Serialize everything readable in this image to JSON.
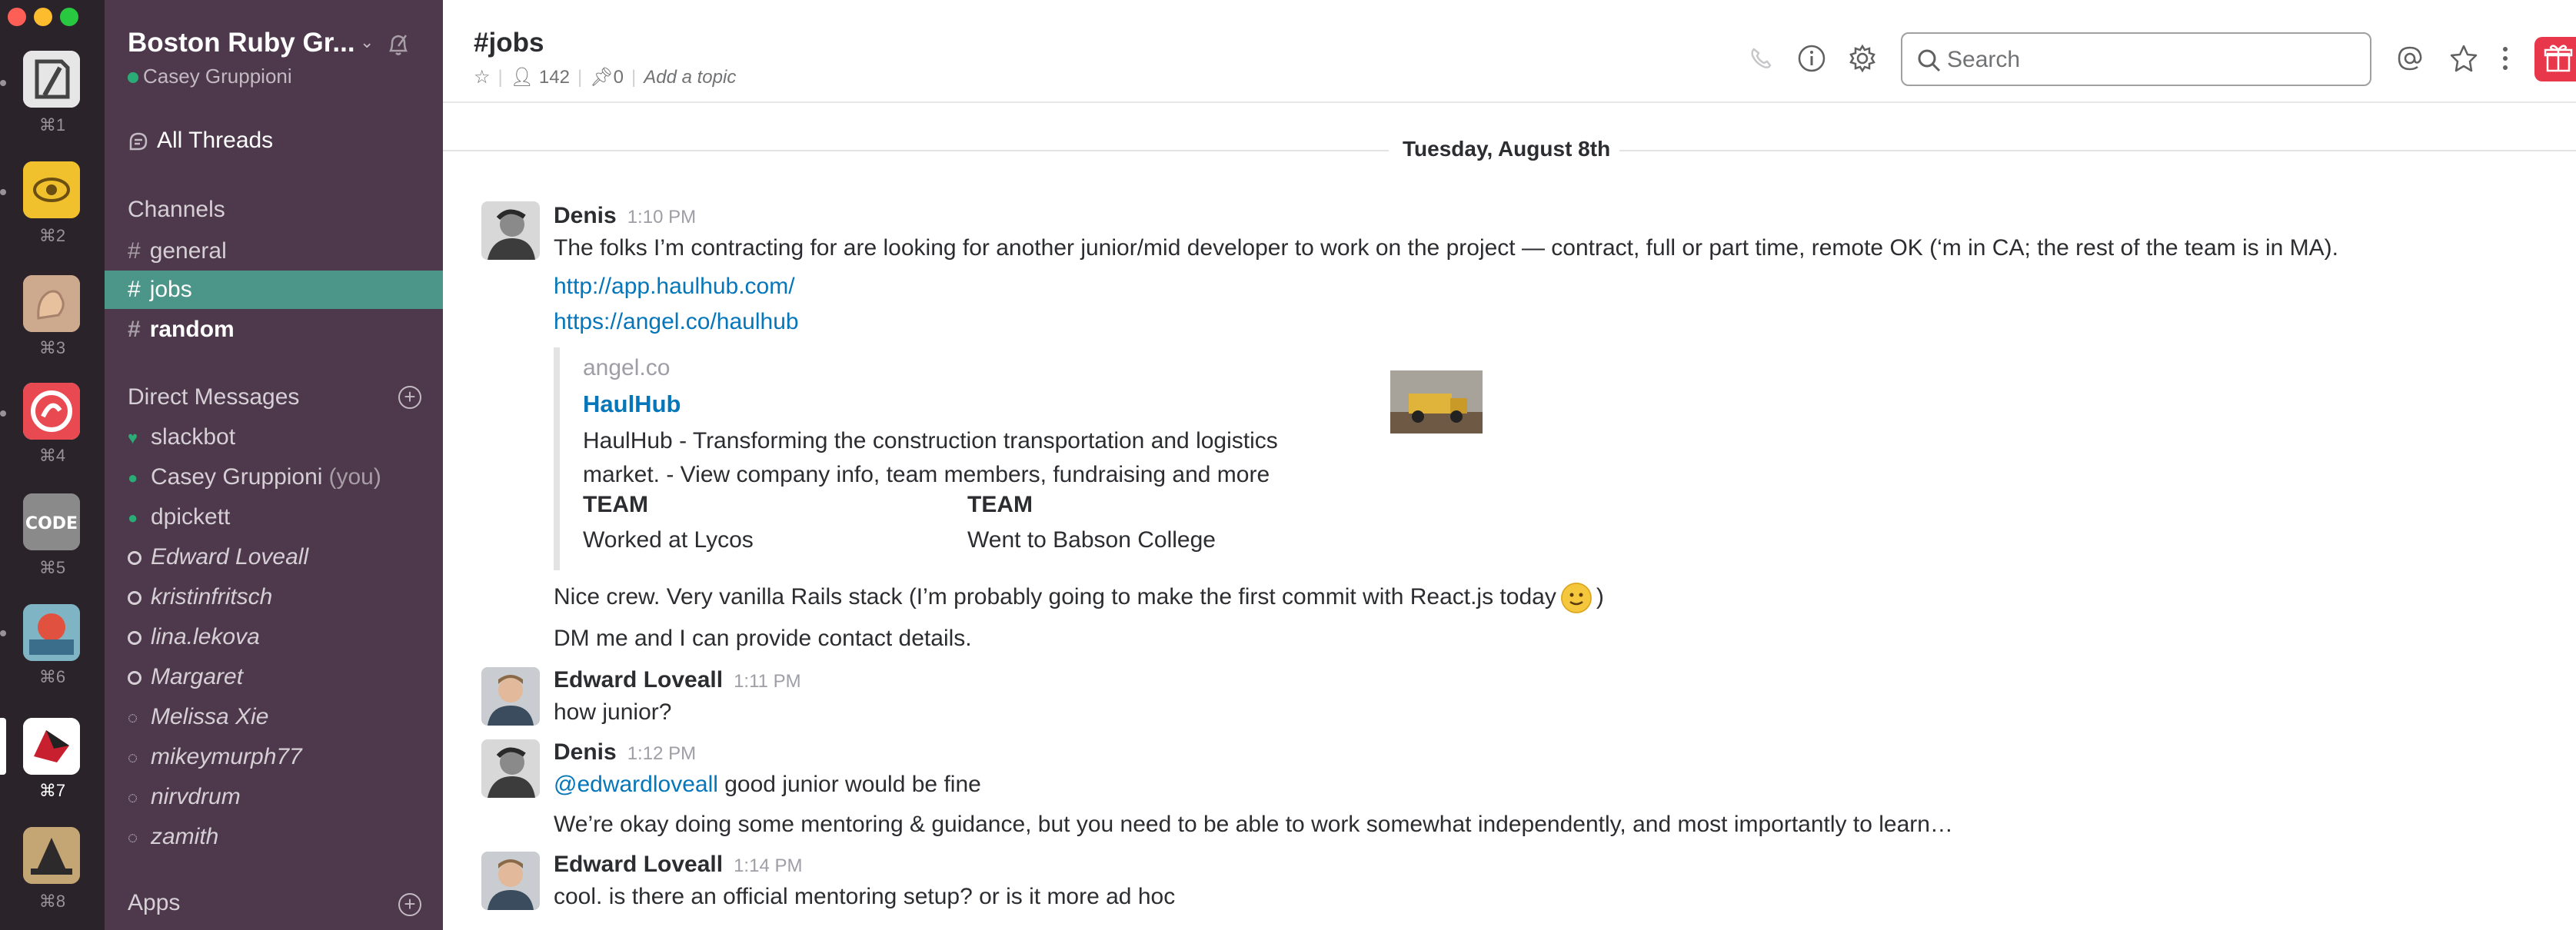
{
  "teams": [
    {
      "key": "⌘1",
      "icon": "team-icon-1"
    },
    {
      "key": "⌘2",
      "icon": "team-icon-2"
    },
    {
      "key": "⌘3",
      "icon": "team-icon-3"
    },
    {
      "key": "⌘4",
      "icon": "team-icon-4"
    },
    {
      "key": "⌘5",
      "icon": "team-icon-5"
    },
    {
      "key": "⌘6",
      "icon": "team-icon-6"
    },
    {
      "key": "⌘7",
      "icon": "team-icon-7"
    },
    {
      "key": "⌘8",
      "icon": "team-icon-8"
    }
  ],
  "sidebar": {
    "team_name": "Boston Ruby Gr...",
    "user_name": "Casey Gruppioni",
    "all_threads": "All Threads",
    "channels_heading": "Channels",
    "channels": [
      {
        "label": "general"
      },
      {
        "label": "jobs"
      },
      {
        "label": "random"
      }
    ],
    "dm_heading": "Direct Messages",
    "dms": [
      {
        "label": "slackbot"
      },
      {
        "label": "Casey Gruppioni",
        "suffix": "(you)"
      },
      {
        "label": "dpickett"
      },
      {
        "label": "Edward Loveall"
      },
      {
        "label": "kristinfritsch"
      },
      {
        "label": "lina.lekova"
      },
      {
        "label": "Margaret"
      },
      {
        "label": "Melissa Xie"
      },
      {
        "label": "mikeymurph77"
      },
      {
        "label": "nirvdrum"
      },
      {
        "label": "zamith"
      }
    ],
    "apps_heading": "Apps"
  },
  "header": {
    "channel_name": "#jobs",
    "member_count": "142",
    "pinned_count": "0",
    "topic_placeholder": "Add a topic",
    "search_placeholder": "Search"
  },
  "messages": {
    "date_divider": "Tuesday, August 8th",
    "m1": {
      "author": "Denis",
      "time": "1:10 PM",
      "text": "The folks I’m contracting for are looking for another junior/mid developer to work on the project — contract, full or part time, remote OK (‘m in CA; the rest of the team is in MA).",
      "link1": "http://app.haulhub.com/",
      "link2": "https://angel.co/haulhub"
    },
    "attachment": {
      "site": "angel.co",
      "title": "HaulHub",
      "description": "HaulHub - Transforming the construction transportation and logistics market. - View company info, team members, fundraising and more",
      "field1_title": "TEAM",
      "field1_value": "Worked at Lycos",
      "field2_title": "TEAM",
      "field2_value": "Went to Babson College"
    },
    "m1_followup1_a": "Nice crew.  Very vanilla Rails stack (I’m probably going to make the first commit with React.js today",
    "m1_followup1_b": ")",
    "m1_followup2": "DM me and I can provide contact details.",
    "m2": {
      "author": "Edward Loveall",
      "time": "1:11 PM",
      "text": "how junior?"
    },
    "m3": {
      "author": "Denis",
      "time": "1:12 PM",
      "mention": "@edwardloveall",
      "text": " good junior would be fine",
      "followup": "We’re okay doing some mentoring & guidance, but you need to be able to work somewhat independently, and most importantly to learn…"
    },
    "m4": {
      "author": "Edward Loveall",
      "time": "1:14 PM",
      "text": "cool. is there an official mentoring setup? or is it more ad hoc"
    }
  },
  "colors": {
    "sidebar_bg": "#4d394b",
    "active_channel": "#4c9689",
    "link": "#0576b9",
    "gift_accent": "#e8374a"
  }
}
